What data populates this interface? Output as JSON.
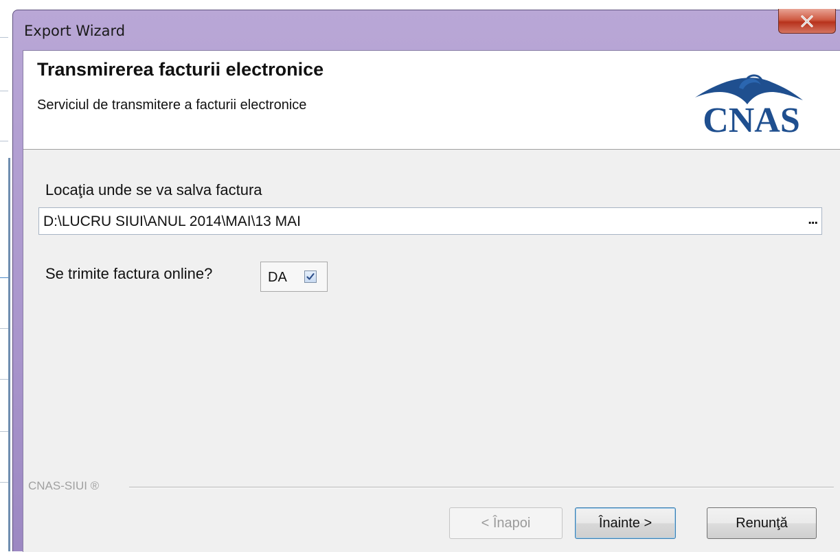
{
  "window": {
    "title": "Export Wizard",
    "close_glyph": "X"
  },
  "header": {
    "title": "Transmirerea facturii electronice",
    "subtitle": "Serviciul de transmitere a facturii electronice",
    "logo_text": "CNAS",
    "logo_icon": "cnas-roof-logo"
  },
  "form": {
    "location_label": "Locaţia unde se va salva factura",
    "location_value": "D:\\LUCRU SIUI\\ANUL 2014\\MAI\\13 MAI",
    "browse_label": "...",
    "online_label": "Se trimite factura online?",
    "online_option_label": "DA",
    "online_checked": true
  },
  "footer": {
    "brand_label": "CNAS-SIUI ®"
  },
  "buttons": {
    "back_label": "< Înapoi",
    "next_label": "Înainte >",
    "cancel_label": "Renunţă"
  },
  "colors": {
    "titlebar": "#a995cc",
    "close_button": "#c9432c",
    "logo_blue": "#1f4f8f",
    "focus_border": "#3c7fb1"
  }
}
